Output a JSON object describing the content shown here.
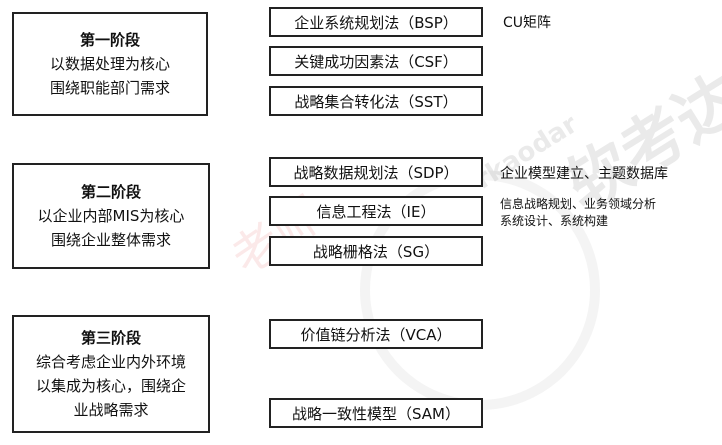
{
  "stages": [
    {
      "title": "第一阶段",
      "lines": [
        "以数据处理为核心",
        "围绕职能部门需求"
      ]
    },
    {
      "title": "第二阶段",
      "lines": [
        "以企业内部MIS为核心",
        "围绕企业整体需求"
      ]
    },
    {
      "title": "第三阶段",
      "lines": [
        "综合考虑企业内外环境",
        "以集成为核心，围绕企",
        "业战略需求"
      ]
    }
  ],
  "methods": [
    "企业系统规划法（BSP）",
    "关键成功因素法（CSF）",
    "战略集合转化法（SST）",
    "战略数据规划法（SDP）",
    "信息工程法（IE）",
    "战略栅格法（SG）",
    "价值链分析法（VCA）",
    "战略一致性模型（SAM）"
  ],
  "notes": {
    "bsp": "CU矩阵",
    "sdp": "企业模型建立、主题数据库",
    "ie_line1": "信息战略规划、业务领域分析",
    "ie_line2": "系统设计、系统构建"
  },
  "watermark": {
    "brand": "软考达",
    "domain": "rkaodar",
    "teacher": "老师",
    "red2": "考："
  }
}
